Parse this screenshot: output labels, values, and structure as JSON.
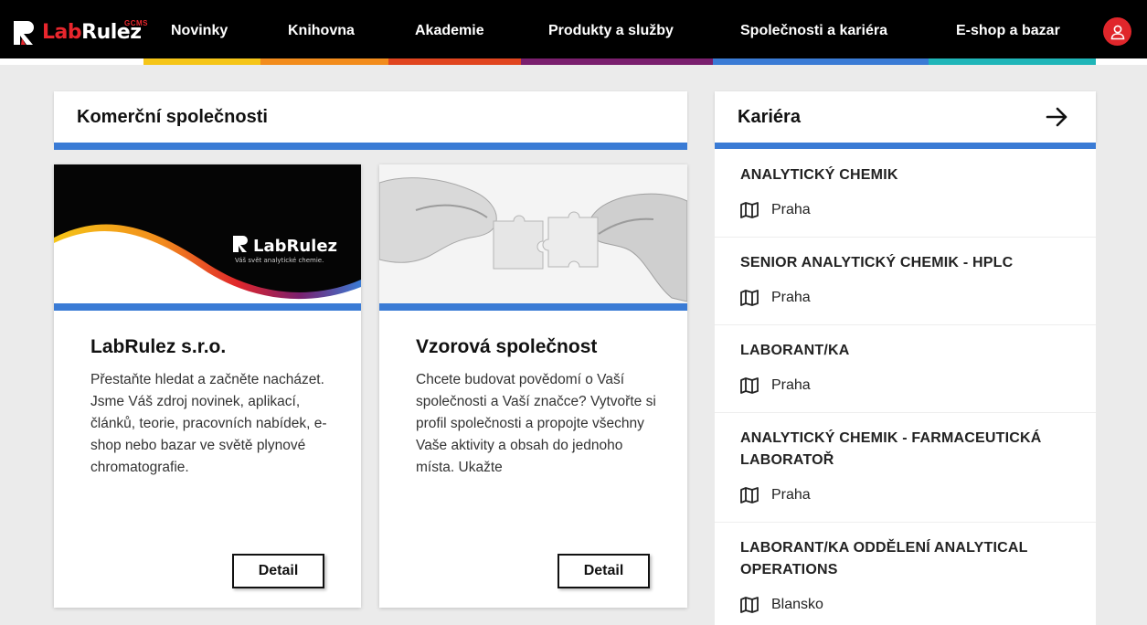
{
  "brand": {
    "name_part1": "Lab",
    "name_part2": "Rulez",
    "sub": "GCMS"
  },
  "nav": {
    "items": [
      "Novinky",
      "Knihovna",
      "Akademie",
      "Produkty a služby",
      "Společnosti a kariéra",
      "E-shop a bazar"
    ]
  },
  "stripe_colors": [
    "#f5c518",
    "#f28c1c",
    "#e0451f",
    "#7a1f6e",
    "#3a7bd5",
    "#1fb5b8"
  ],
  "companies": {
    "heading": "Komerční společnosti",
    "cards": [
      {
        "title": "LabRulez s.r.o.",
        "text": "Přestaňte hledat a začněte nacházet. Jsme Váš zdroj novinek, aplikací, článků, teorie, pracovních nabídek, e-shop nebo bazar ve světě plynové chromatografie.",
        "logo_text": "LabRulez",
        "logo_tagline": "Váš svět analytické chemie.",
        "button": "Detail"
      },
      {
        "title": "Vzorová společnost",
        "text": "Chcete budovat povědomí o Vaší společnosti a Vaší značce? Vytvořte si profil společnosti a propojte všechny Vaše aktivity a obsah do jednoho místa. Ukažte",
        "button": "Detail"
      }
    ]
  },
  "career": {
    "heading": "Kariéra",
    "jobs": [
      {
        "title": "ANALYTICKÝ CHEMIK",
        "location": "Praha"
      },
      {
        "title": "SENIOR ANALYTICKÝ CHEMIK - HPLC",
        "location": "Praha"
      },
      {
        "title": "LABORANT/KA",
        "location": "Praha"
      },
      {
        "title": "ANALYTICKÝ CHEMIK - FARMACEUTICKÁ LABORATOŘ",
        "location": "Praha"
      },
      {
        "title": "LABORANT/KA ODDĚLENÍ ANALYTICAL OPERATIONS",
        "location": "Blansko"
      }
    ]
  },
  "colors": {
    "accent_blue": "#3a7bd5",
    "brand_red": "#e0262b"
  }
}
